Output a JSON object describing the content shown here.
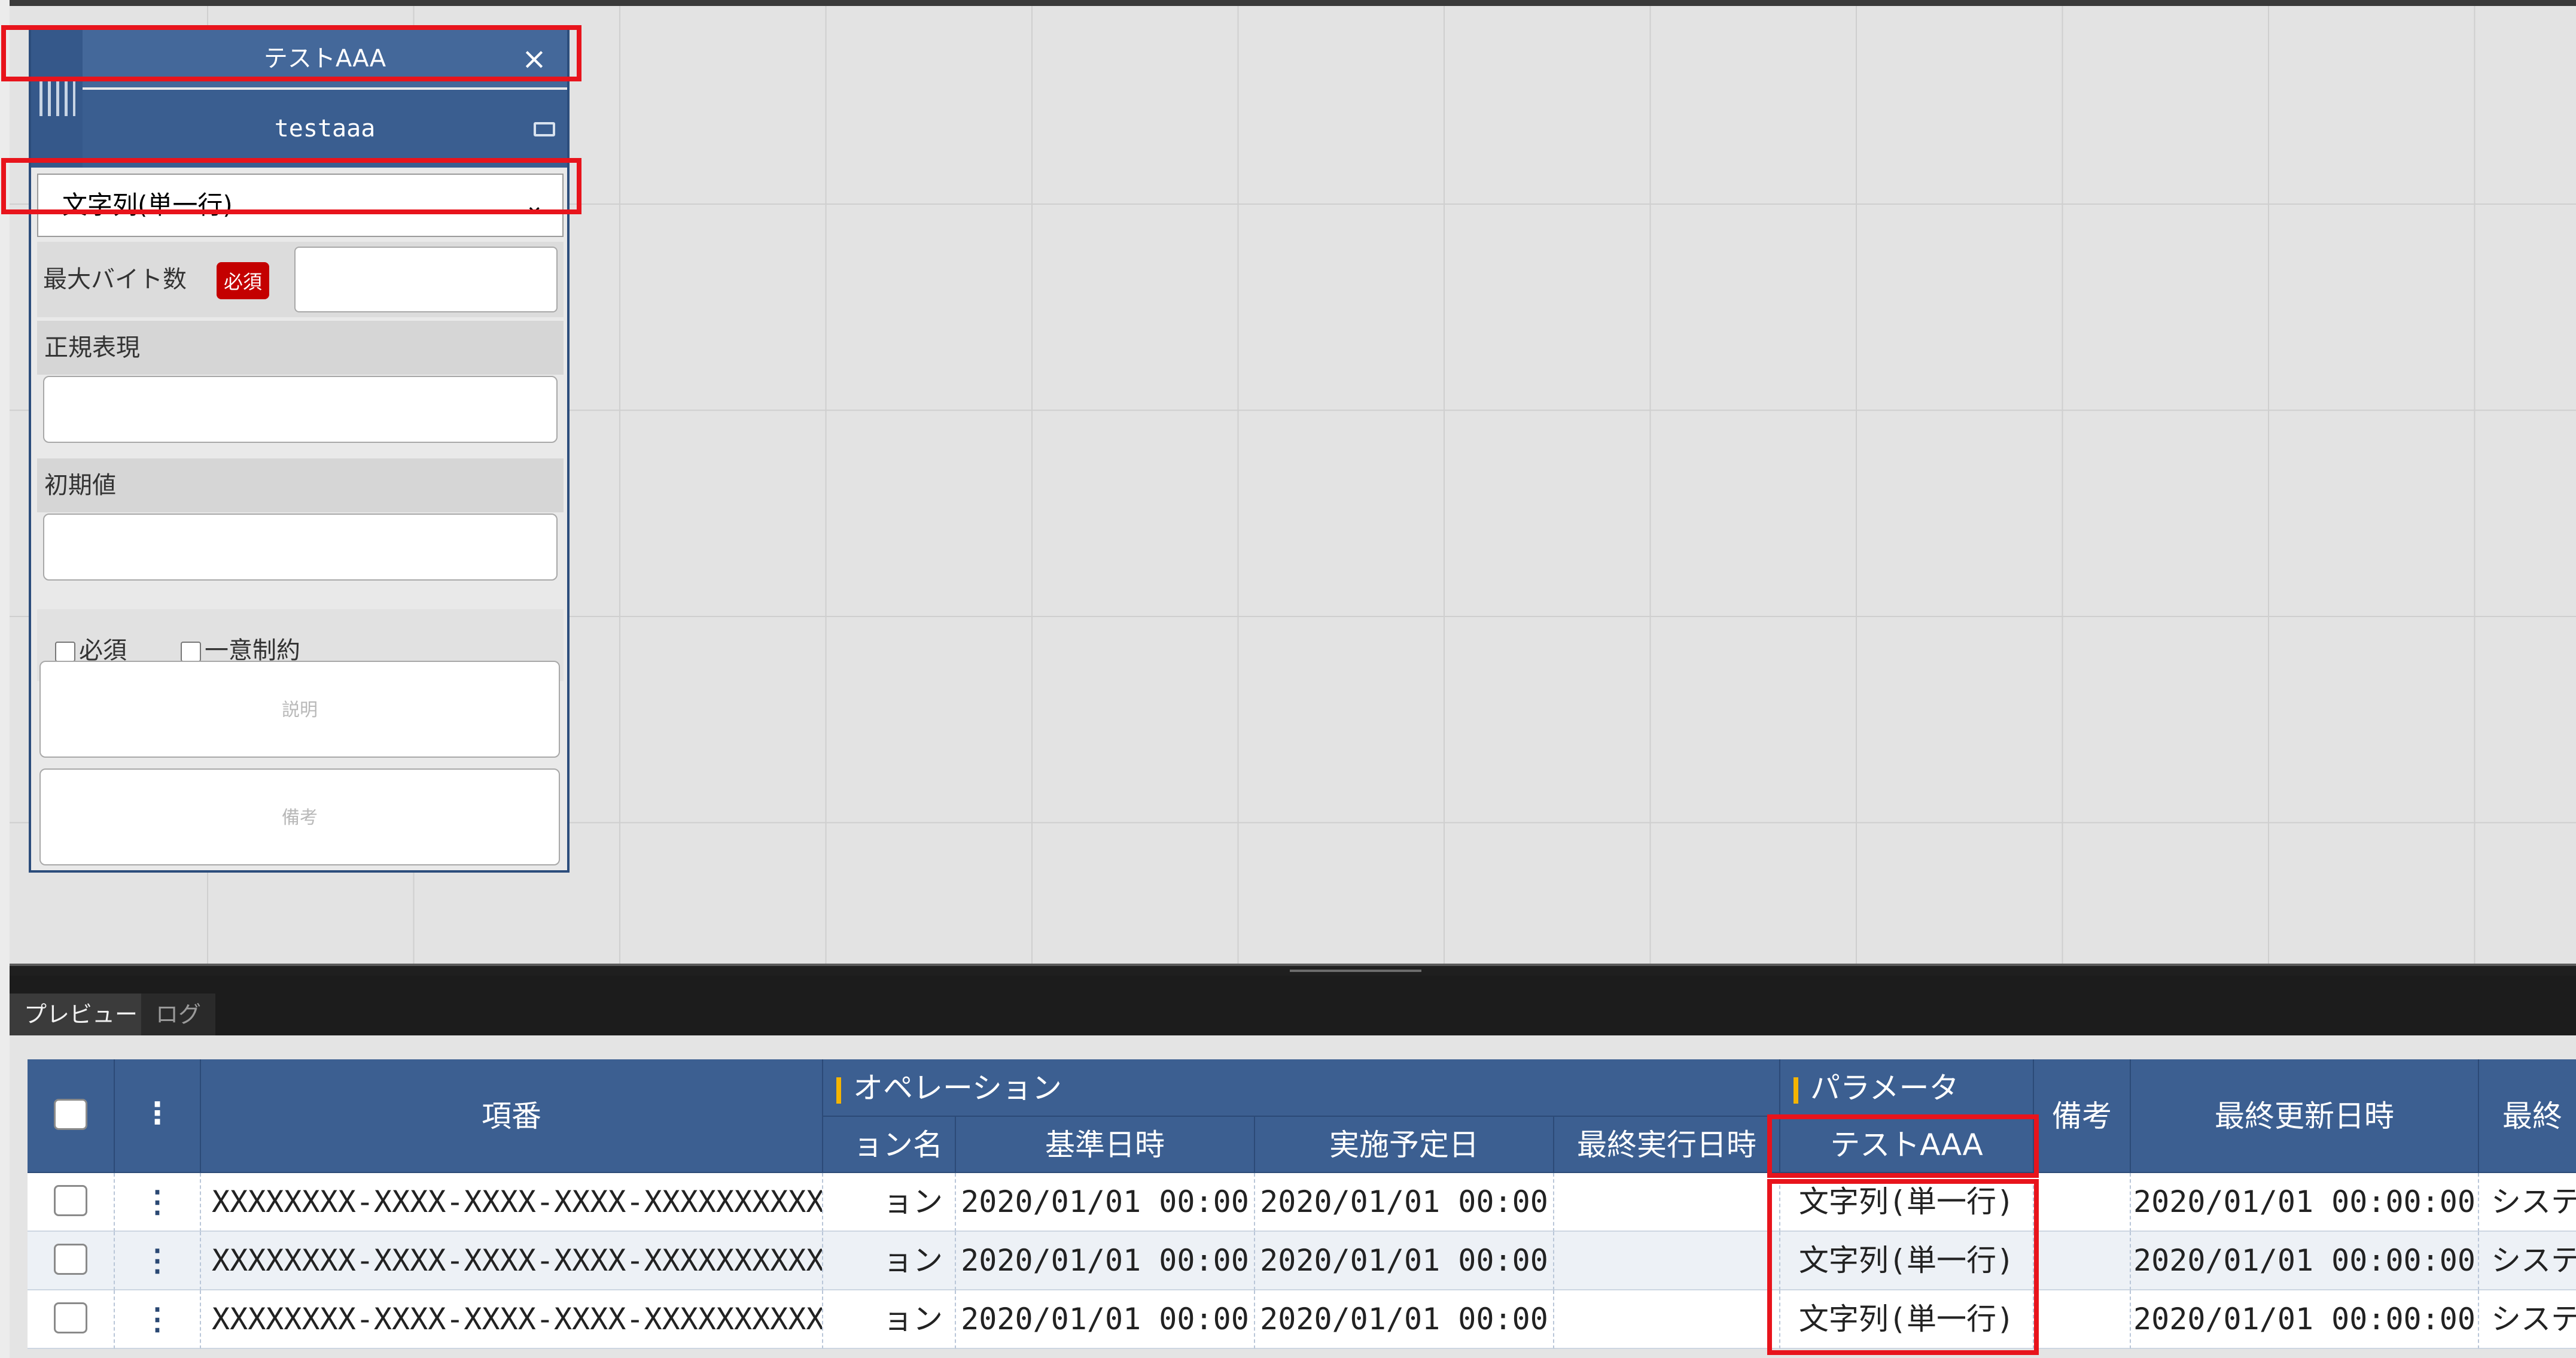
{
  "panel": {
    "title": "テストAAA",
    "close_icon": "×",
    "subtitle": "testaaa",
    "type_select": {
      "value": "文字列(単一行)",
      "chevron": "⌄"
    },
    "max_bytes": {
      "label": "最大バイト数",
      "badge": "必須",
      "value": ""
    },
    "regex": {
      "label": "正規表現",
      "value": ""
    },
    "default_value": {
      "label": "初期値",
      "value": ""
    },
    "checkboxes": [
      {
        "label": "必須",
        "checked": false
      },
      {
        "label": "一意制約",
        "checked": false
      }
    ],
    "description_placeholder": "説明",
    "note_placeholder": "備考"
  },
  "tabs": [
    {
      "label": "プレビュー",
      "active": true
    },
    {
      "label": "ログ",
      "active": false
    }
  ],
  "table": {
    "group_headers": {
      "operation": "オペレーション",
      "parameter": "パラメータ"
    },
    "headers": {
      "kebab": "⋮",
      "item_no": "項番",
      "operation_name": "ョン名",
      "base_datetime": "基準日時",
      "scheduled_date": "実施予定日",
      "last_exec": "最終実行日時",
      "test_aaa": "テストAAA",
      "remarks": "備考",
      "last_updated": "最終更新日時",
      "last_updater": "最終"
    },
    "rows": [
      {
        "item_no": "XXXXXXXX-XXXX-XXXX-XXXX-XXXXXXXXXXXX",
        "operation_name": "ョン",
        "base_datetime": "2020/01/01 00:00",
        "scheduled_date": "2020/01/01 00:00",
        "last_exec": "",
        "test_aaa": "文字列(単一行)",
        "remarks": "",
        "last_updated": "2020/01/01 00:00:00",
        "last_updater": "システ"
      },
      {
        "item_no": "XXXXXXXX-XXXX-XXXX-XXXX-XXXXXXXXXXXX",
        "operation_name": "ョン",
        "base_datetime": "2020/01/01 00:00",
        "scheduled_date": "2020/01/01 00:00",
        "last_exec": "",
        "test_aaa": "文字列(単一行)",
        "remarks": "",
        "last_updated": "2020/01/01 00:00:00",
        "last_updater": "システ"
      },
      {
        "item_no": "XXXXXXXX-XXXX-XXXX-XXXX-XXXXXXXXXXXX",
        "operation_name": "ョン",
        "base_datetime": "2020/01/01 00:00",
        "scheduled_date": "2020/01/01 00:00",
        "last_exec": "",
        "test_aaa": "文字列(単一行)",
        "remarks": "",
        "last_updated": "2020/01/01 00:00:00",
        "last_updater": "システ"
      }
    ]
  },
  "colors": {
    "header_blue": "#3c5f91",
    "highlight_red": "#e8141c",
    "required_badge": "#c40000",
    "group_bar": "#f4b400"
  }
}
